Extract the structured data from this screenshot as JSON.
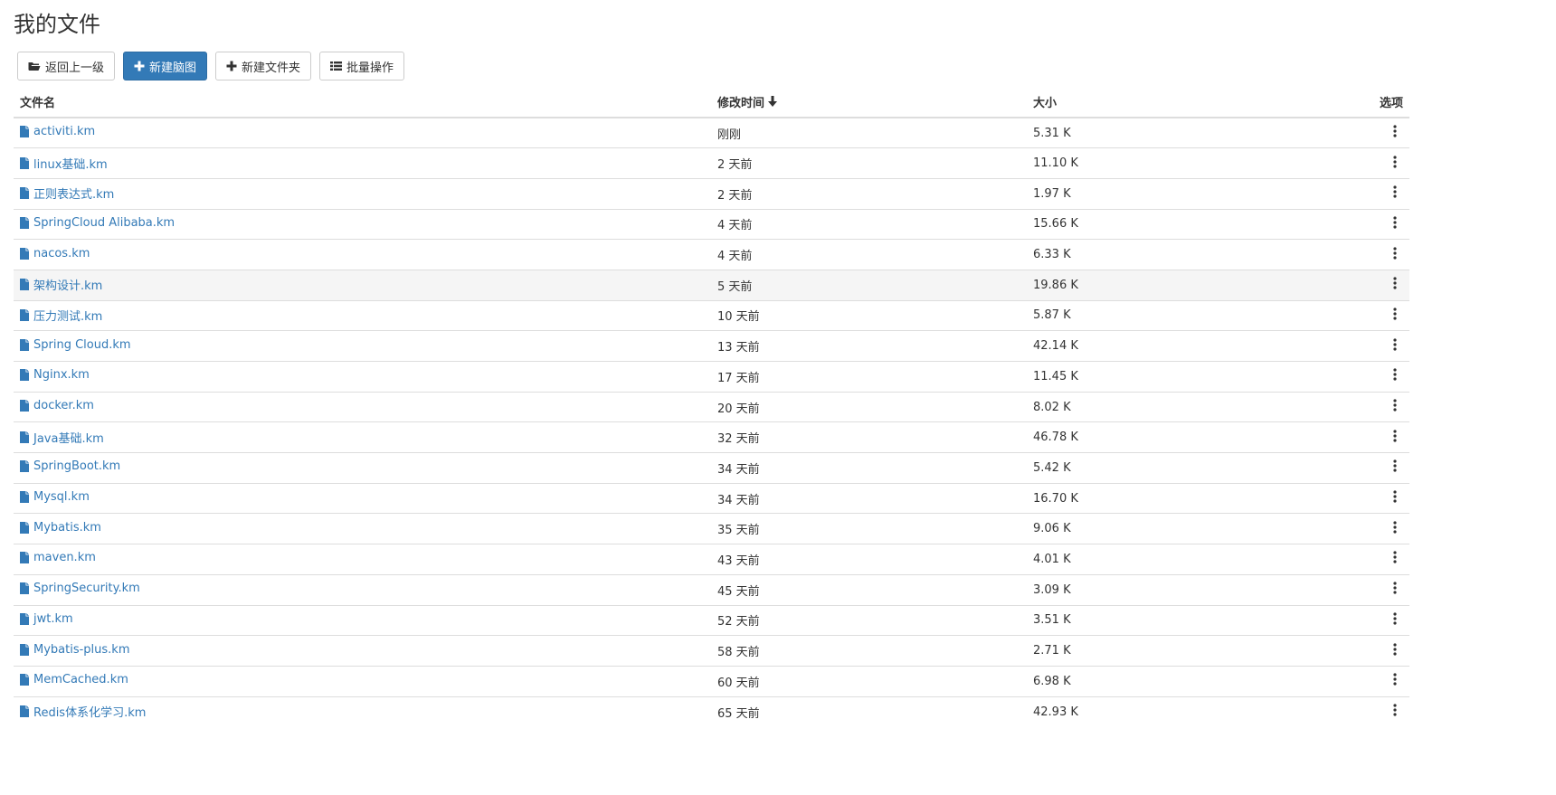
{
  "page": {
    "title": "我的文件"
  },
  "toolbar": {
    "back_label": "返回上一级",
    "new_mindmap_label": "新建脑图",
    "new_folder_label": "新建文件夹",
    "batch_label": "批量操作"
  },
  "table": {
    "headers": {
      "name": "文件名",
      "modified": "修改时间",
      "size": "大小",
      "options": "选项"
    },
    "sort_column": "modified",
    "sort_direction": "desc",
    "highlighted_row": 5,
    "rows": [
      {
        "name": "activiti.km",
        "modified": "刚刚",
        "size": "5.31 K"
      },
      {
        "name": "linux基础.km",
        "modified": "2 天前",
        "size": "11.10 K"
      },
      {
        "name": "正则表达式.km",
        "modified": "2 天前",
        "size": "1.97 K"
      },
      {
        "name": "SpringCloud Alibaba.km",
        "modified": "4 天前",
        "size": "15.66 K"
      },
      {
        "name": "nacos.km",
        "modified": "4 天前",
        "size": "6.33 K"
      },
      {
        "name": "架构设计.km",
        "modified": "5 天前",
        "size": "19.86 K"
      },
      {
        "name": "压力测试.km",
        "modified": "10 天前",
        "size": "5.87 K"
      },
      {
        "name": "Spring Cloud.km",
        "modified": "13 天前",
        "size": "42.14 K"
      },
      {
        "name": "Nginx.km",
        "modified": "17 天前",
        "size": "11.45 K"
      },
      {
        "name": "docker.km",
        "modified": "20 天前",
        "size": "8.02 K"
      },
      {
        "name": "Java基础.km",
        "modified": "32 天前",
        "size": "46.78 K"
      },
      {
        "name": "SpringBoot.km",
        "modified": "34 天前",
        "size": "5.42 K"
      },
      {
        "name": "Mysql.km",
        "modified": "34 天前",
        "size": "16.70 K"
      },
      {
        "name": "Mybatis.km",
        "modified": "35 天前",
        "size": "9.06 K"
      },
      {
        "name": "maven.km",
        "modified": "43 天前",
        "size": "4.01 K"
      },
      {
        "name": "SpringSecurity.km",
        "modified": "45 天前",
        "size": "3.09 K"
      },
      {
        "name": "jwt.km",
        "modified": "52 天前",
        "size": "3.51 K"
      },
      {
        "name": "Mybatis-plus.km",
        "modified": "58 天前",
        "size": "2.71 K"
      },
      {
        "name": "MemCached.km",
        "modified": "60 天前",
        "size": "6.98 K"
      },
      {
        "name": "Redis体系化学习.km",
        "modified": "65 天前",
        "size": "42.93 K"
      }
    ]
  },
  "icons": {
    "back": "folder-open-icon",
    "new_mindmap": "plus-icon",
    "new_folder": "plus-icon",
    "batch": "list-icon",
    "file": "file-icon",
    "sort": "arrow-down-icon",
    "options": "more-vertical-icon"
  },
  "colors": {
    "link": "#337ab7",
    "primary_button": "#337ab7",
    "row_highlight": "#f5f5f5",
    "border": "#dddddd"
  }
}
